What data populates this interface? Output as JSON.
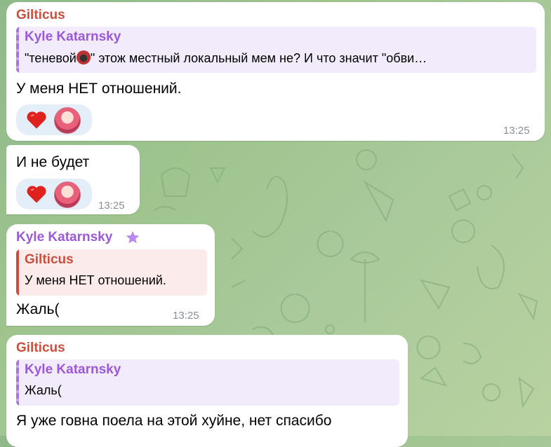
{
  "colors": {
    "gilticus_name": "#c9503f",
    "kyle_name": "#9b59d8",
    "quote_bg_kyle": "#f1ebfb",
    "quote_bar_kyle": "#a873e0",
    "quote_bg_gilticus": "#fbebeb",
    "quote_bar_gilticus": "#d04a3a",
    "reaction_bg": "#e3eef8"
  },
  "messages": [
    {
      "sender": "Gilticus",
      "reply_to": "Kyle Katarnsky",
      "reply_text_before": "\"теневой",
      "reply_emoji": "ninja-emoji",
      "reply_text_after": "\" этож местный локальный мем не? И что значит \"обви…",
      "text": "У меня НЕТ отношений.",
      "time": "13:25",
      "reactions": [
        "heart",
        "user-avatar"
      ]
    },
    {
      "sender": "",
      "text": "И не будет",
      "time": "13:25",
      "reactions": [
        "heart",
        "user-avatar"
      ]
    },
    {
      "sender": "Kyle Katarnsky",
      "sender_badge": "star-icon",
      "reply_to": "Gilticus",
      "reply_text": "У меня НЕТ отношений.",
      "text": "Жаль(",
      "time": "13:25"
    },
    {
      "sender": "Gilticus",
      "reply_to": "Kyle Katarnsky",
      "reply_text": "Жаль(",
      "text": "Я уже говна поела на этой хуйне, нет спасибо"
    }
  ]
}
